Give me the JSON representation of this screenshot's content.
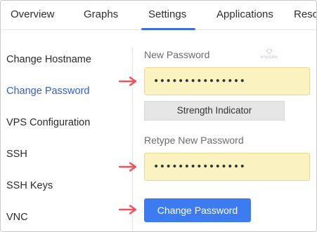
{
  "tabs": [
    {
      "label": "Overview"
    },
    {
      "label": "Graphs"
    },
    {
      "label": "Settings"
    },
    {
      "label": "Applications"
    },
    {
      "label": "Reso"
    }
  ],
  "active_tab": "Settings",
  "sidebar": {
    "items": [
      {
        "label": "Change Hostname"
      },
      {
        "label": "Change Password"
      },
      {
        "label": "VPS Configuration"
      },
      {
        "label": "SSH"
      },
      {
        "label": "SSH Keys"
      },
      {
        "label": "VNC"
      }
    ],
    "active_item": "Change Password"
  },
  "form": {
    "new_password_label": "New Password",
    "new_password_value": "•••••••••••••••",
    "strength_label": "Strength Indicator",
    "retype_password_label": "Retype New Password",
    "retype_password_value": "•••••••••••••••",
    "submit_label": "Change Password"
  },
  "watermark_text": "envision",
  "colors": {
    "accent": "#3d6ee8",
    "button": "#3d7bf0",
    "field_bg": "#fbf2c2",
    "annotation_arrow": "#f0525a"
  },
  "icons": {
    "annotation_arrow": "right-arrow-icon"
  }
}
